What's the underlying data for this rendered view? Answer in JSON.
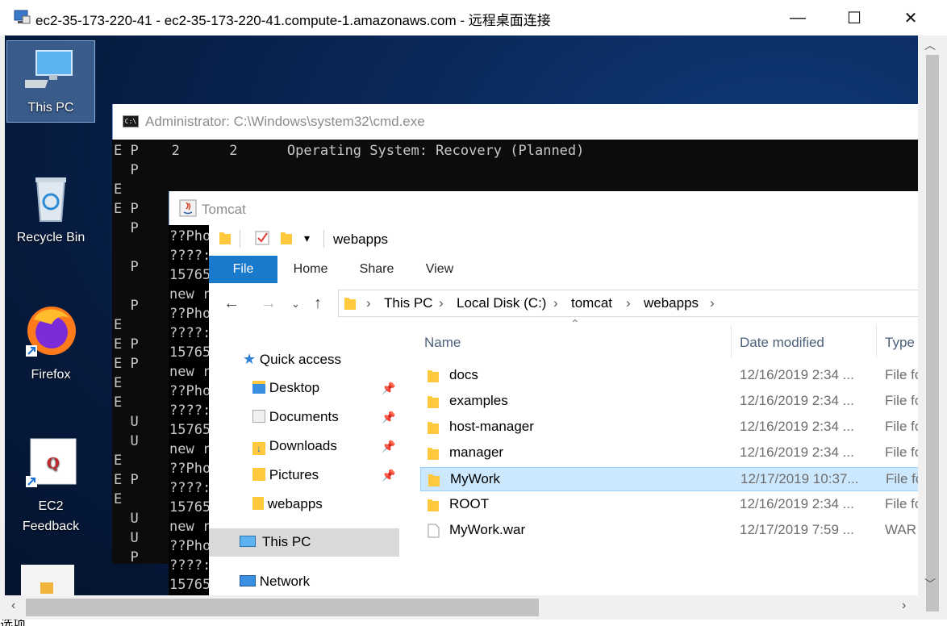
{
  "rdp": {
    "title": "ec2-35-173-220-41 - ec2-35-173-220-41.compute-1.amazonaws.com - 远程桌面连接",
    "minimize": "—",
    "maximize": "☐",
    "close": "✕"
  },
  "desktop": {
    "icons": [
      {
        "label": "This PC",
        "icon": "computer-icon"
      },
      {
        "label": "Recycle Bin",
        "icon": "recycle-bin-icon"
      },
      {
        "label": "Firefox",
        "icon": "firefox-icon"
      },
      {
        "label": "EC2\nFeedback",
        "icon": "ec2-feedback-icon"
      }
    ]
  },
  "cmd": {
    "title": "Administrator: C:\\Windows\\system32\\cmd.exe",
    "first_line": "E P    2      2      Operating System: Recovery (Planned)",
    "left_col": [
      "  P",
      "E",
      "E P",
      "  P",
      "",
      "  P",
      "",
      "  P",
      "E",
      "E P",
      "E P",
      "E",
      "E",
      "  U",
      "  U",
      "E",
      "E P",
      "E",
      "  U",
      "  U",
      "  P"
    ]
  },
  "tomcat": {
    "title": "Tomcat",
    "lines": [
      "??Pho",
      "????:",
      "15765",
      "new r",
      "??Pho",
      "????:",
      "15765",
      "new r",
      "??Pho",
      "????:",
      "15765",
      "new r",
      "??Pho",
      "????:",
      "15765",
      "new r",
      "??Pho",
      "????:",
      "15765"
    ]
  },
  "explorer": {
    "qat_path": "webapps",
    "tabs": [
      "File",
      "Home",
      "Share",
      "View"
    ],
    "breadcrumb": [
      "This PC",
      "Local Disk (C:)",
      "tomcat",
      "webapps"
    ],
    "nav": {
      "quick_access": "Quick access",
      "items": [
        "Desktop",
        "Documents",
        "Downloads",
        "Pictures",
        "webapps"
      ],
      "this_pc": "This PC",
      "network": "Network"
    },
    "columns": {
      "name": "Name",
      "date": "Date modified",
      "type": "Type"
    },
    "files": [
      {
        "name": "docs",
        "date": "12/16/2019 2:34 ...",
        "type": "File fo",
        "kind": "folder"
      },
      {
        "name": "examples",
        "date": "12/16/2019 2:34 ...",
        "type": "File fo",
        "kind": "folder"
      },
      {
        "name": "host-manager",
        "date": "12/16/2019 2:34 ...",
        "type": "File fo",
        "kind": "folder"
      },
      {
        "name": "manager",
        "date": "12/16/2019 2:34 ...",
        "type": "File fo",
        "kind": "folder"
      },
      {
        "name": "MyWork",
        "date": "12/17/2019 10:37...",
        "type": "File fo",
        "kind": "folder"
      },
      {
        "name": "ROOT",
        "date": "12/16/2019 2:34 ...",
        "type": "File fo",
        "kind": "folder"
      },
      {
        "name": "MyWork.war",
        "date": "12/17/2019 7:59 ...",
        "type": "WAR",
        "kind": "file"
      }
    ]
  },
  "status": {
    "partial_text": "选项"
  },
  "colors": {
    "accent": "#1979ca",
    "selection": "#cce8ff",
    "desktop": "#0a2858"
  }
}
